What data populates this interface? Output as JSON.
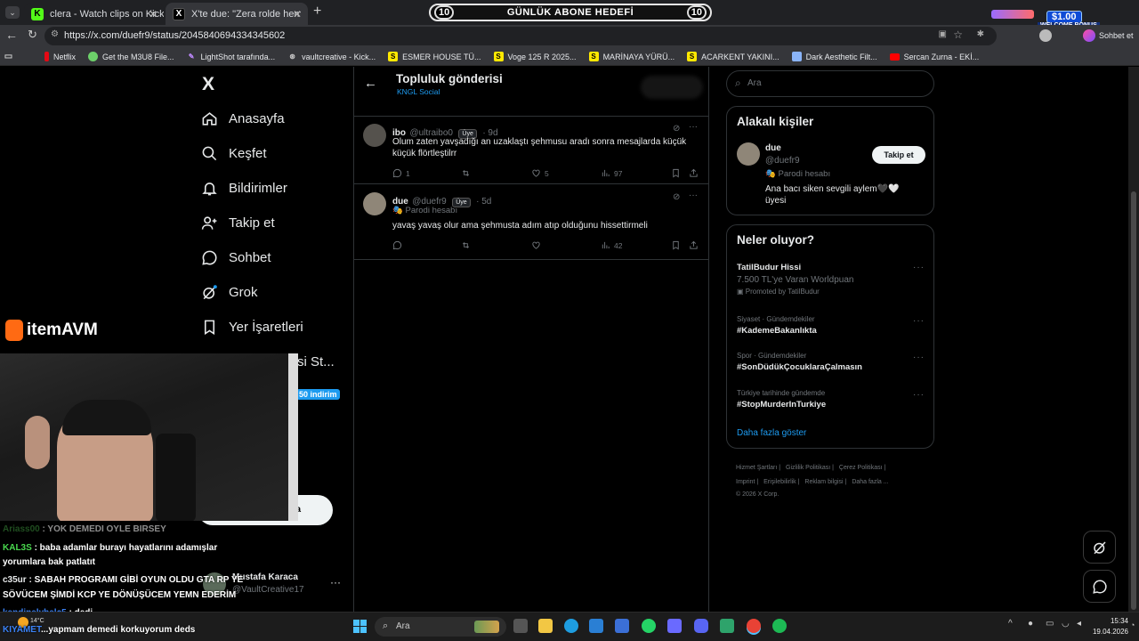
{
  "browser": {
    "tabs": [
      {
        "title": "clera - Watch clips on Kick",
        "favicon": "K"
      },
      {
        "title": "X'te due: \"Zera rolde hemen yavşa",
        "favicon": "X"
      }
    ],
    "new_tab_icon": "+",
    "url": "https://x.com/duefr9/status/2045840694334345602",
    "bookmarks": [
      "Netflix",
      "Get the M3U8 File...",
      "LightShot tarafında...",
      "vaultcreative - Kick...",
      "ESMER HOUSE TÜ...",
      "Voge 125 R 2025...",
      "MARİNAYA YÜRÜ...",
      "ACARKENT YAKINI...",
      "Dark Aesthetic Filt...",
      "Sercan Zurna - EKİ..."
    ],
    "profile_label": "Sohbet et"
  },
  "overlay": {
    "goal_left": "10",
    "goal_title": "GÜNLÜK ABONE HEDEFİ",
    "goal_right": "10",
    "welcome_amount": "$1.00",
    "welcome_text": "WELCOME BONUS",
    "sponsor": "itemAVM",
    "chat": [
      {
        "user": "Ariass00",
        "text": ": YOK DEMEDI OYLE BIRSEY",
        "color": "#3b8f3b"
      },
      {
        "user": "KAL3S",
        "text": ": baba adamlar burayı hayatlarını adamışlar",
        "color": "#49d94e"
      },
      {
        "user": "",
        "text": "yorumlara bak patlatıt",
        "color": "#ffffff"
      },
      {
        "user": "c35ur",
        "text": ": SABAH PROGRAMI GİBİ OYUN OLDU GTA RP YE",
        "color": "#e7e9ea"
      },
      {
        "user": "",
        "text": "SÖVÜCEM ŞİMDİ KCP YE DÖNÜŞÜCEM YEMN EDERİM",
        "color": "#ffffff"
      },
      {
        "user": "kendinelybelc5",
        "text": ": dedi",
        "color": "#3b82f6"
      },
      {
        "user": "KIYAMET",
        "text": "...yapmam demedi korkuyorum deds",
        "color": "#3b82f6"
      }
    ]
  },
  "sidebar": {
    "logo": "X",
    "items": [
      "Anasayfa",
      "Keşfet",
      "Bildirimler",
      "Takip et",
      "Sohbet",
      "Grok",
      "Yer İşaretleri"
    ],
    "partial_text": "si St...",
    "promo_badge": "50 indirim",
    "account_name": "Mustafa Karaca",
    "account_handle": "@VaultCreative17"
  },
  "main": {
    "title": "Topluluk gönderisi",
    "subtitle": "KNGL Social",
    "tweets": [
      {
        "name": "ibo",
        "handle": "@ultraibo0",
        "badge": "Üye",
        "time": "· 9d",
        "parody": "",
        "text_line1": "Olum zaten yavşadığı an uzaklaştı şehmusu aradı sonra mesajlarda küçük",
        "text_line2": "küçük flörtleştilrr",
        "replies": "1",
        "reposts": "",
        "likes": "5",
        "views": "97"
      },
      {
        "name": "due",
        "handle": "@duefr9",
        "badge": "Üye",
        "time": "· 5d",
        "parody": "Parodi hesabı",
        "text_line1": "yavaş yavaş olur ama şehmusta adım atıp olduğunu hissettirmeli",
        "text_line2": "",
        "replies": "",
        "reposts": "",
        "likes": "",
        "views": "42"
      }
    ]
  },
  "right": {
    "search_placeholder": "Ara",
    "relevant": {
      "title": "Alakalı kişiler",
      "name": "due",
      "handle": "@duefr9",
      "parody": "Parodi hesabı",
      "follow": "Takip et",
      "bio_line1": "Ana bacı siken sevgili aylem🖤🤍",
      "bio_line2": "üyesi"
    },
    "whats_happening": {
      "title": "Neler oluyor?",
      "trends": [
        {
          "context": "TatilBudur Hissi",
          "title": "7.500 TL'ye Varan Worldpuan",
          "extra": "Promoted by TatilBudur"
        },
        {
          "context": "Siyaset · Gündemdekiler",
          "title": "#KademeBakanlıkta",
          "extra": ""
        },
        {
          "context": "Spor · Gündemdekiler",
          "title": "#SonDüdükÇocuklaraÇalmasın",
          "extra": ""
        },
        {
          "context": "Türkiye tarihinde gündemde",
          "title": "#StopMurderInTurkiye",
          "extra": ""
        }
      ],
      "more": "Daha fazla göster"
    },
    "footer_line1": [
      "Hizmet Şartları",
      "Gizlilik Politikası",
      "Çerez Politikası"
    ],
    "footer_line2": [
      "Imprint",
      "Erişilebilirlik",
      "Reklam bilgisi",
      "Daha fazla ..."
    ],
    "copyright": "© 2026 X Corp."
  },
  "taskbar": {
    "search": "Ara",
    "weather": "14°C",
    "time": "15:34",
    "date": "19.04.2026"
  },
  "colors": {
    "accent": "#1d9bf0",
    "bg": "#000000",
    "border": "#2f3336",
    "muted": "#71767b"
  }
}
